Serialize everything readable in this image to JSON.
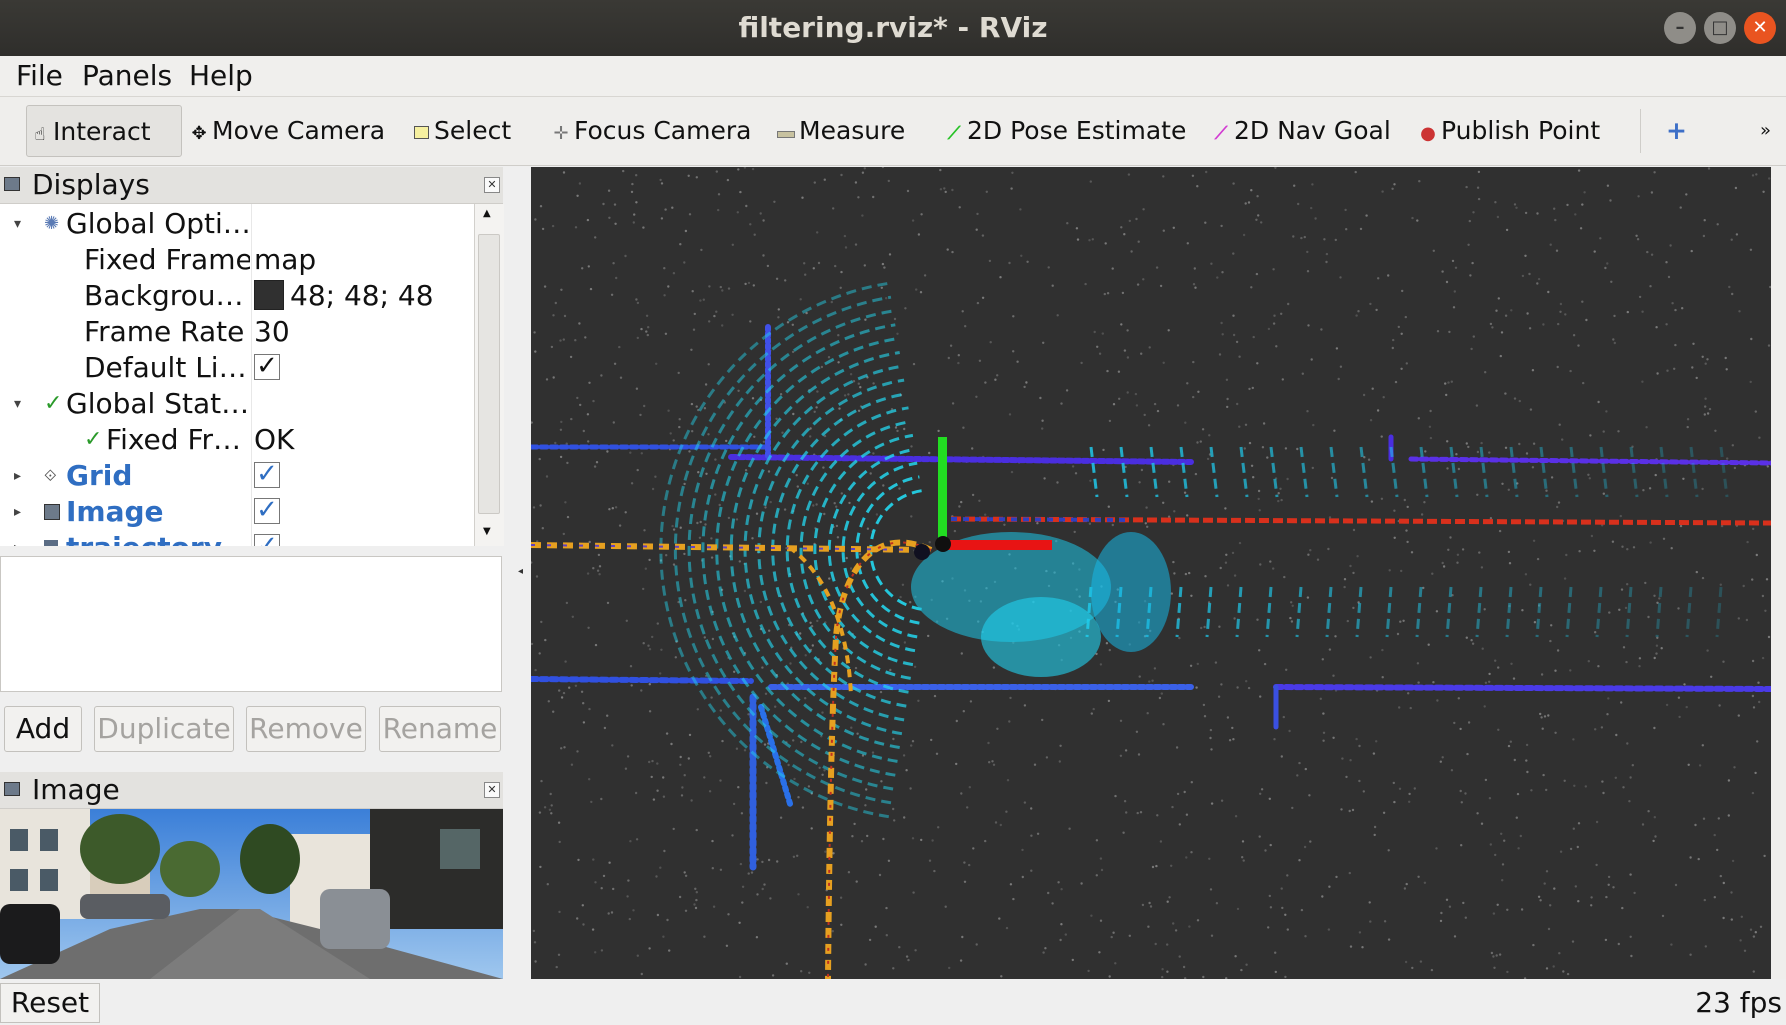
{
  "window": {
    "title": "filtering.rviz* - RViz"
  },
  "menu": [
    {
      "label": "File"
    },
    {
      "label": "Panels"
    },
    {
      "label": "Help"
    }
  ],
  "toolbar": {
    "tools": [
      {
        "label": "Interact",
        "icon": "hand-icon"
      },
      {
        "label": "Move Camera",
        "icon": "move-icon"
      },
      {
        "label": "Select",
        "icon": "select-icon"
      },
      {
        "label": "Focus Camera",
        "icon": "focus-icon"
      },
      {
        "label": "Measure",
        "icon": "ruler-icon"
      },
      {
        "label": "2D Pose Estimate",
        "icon": "green-arrow-icon"
      },
      {
        "label": "2D Nav Goal",
        "icon": "pink-arrow-icon"
      },
      {
        "label": "Publish Point",
        "icon": "pin-icon"
      }
    ],
    "add_tool": "+",
    "more": "»"
  },
  "displays_panel": {
    "title": "Displays",
    "rows": [
      {
        "name": "Global Opti…",
        "value": ""
      },
      {
        "name": "Fixed Frame",
        "value": "map"
      },
      {
        "name": "Backgrou…",
        "value": "48; 48; 48",
        "swatch": "#303030"
      },
      {
        "name": "Frame Rate",
        "value": "30"
      },
      {
        "name": "Default Li…",
        "value": "✓"
      },
      {
        "name": "Global Stat…",
        "value": ""
      },
      {
        "name": "Fixed Fr…",
        "value": "OK"
      },
      {
        "name": "Grid",
        "value": "✓"
      },
      {
        "name": "Image",
        "value": "✓"
      },
      {
        "name": "trajectory",
        "value": "✓"
      }
    ],
    "buttons": {
      "add": "Add",
      "duplicate": "Duplicate",
      "remove": "Remove",
      "rename": "Rename"
    }
  },
  "image_panel": {
    "title": "Image"
  },
  "status": {
    "reset": "Reset",
    "fps": "23 fps"
  },
  "colors": {
    "background": "#303030",
    "accent": "#2f6ec2",
    "close": "#e95420"
  }
}
